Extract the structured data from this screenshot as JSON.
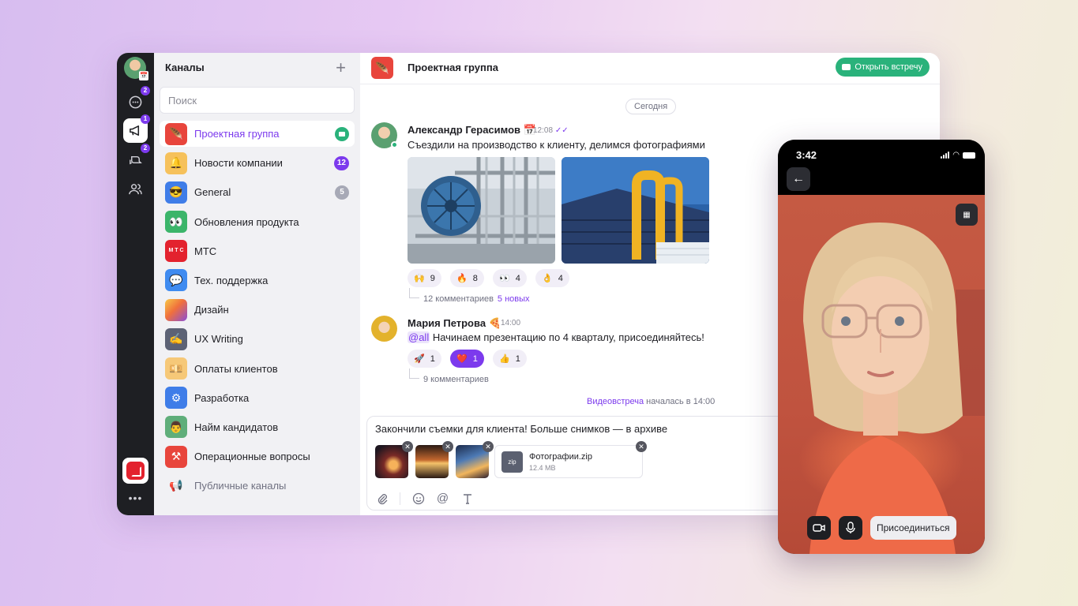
{
  "rail": {
    "chat_badge": "2",
    "channels_badge": "1",
    "threads_badge": "2",
    "more_label": "•••"
  },
  "sidebar": {
    "title": "Каналы",
    "add_icon": "+",
    "search_placeholder": "Поиск",
    "channels": [
      {
        "name": "Проектная группа",
        "icon": "🪶",
        "color": "#e8453c",
        "active": true,
        "call": true
      },
      {
        "name": "Новости компании",
        "icon": "🔔",
        "color": "#f6c15b",
        "count": "12"
      },
      {
        "name": "General",
        "icon": "😎",
        "color": "#3f7de8",
        "count": "5",
        "muted": true
      },
      {
        "name": "Обновления продукта",
        "icon": "👀",
        "color": "#3bb56a"
      },
      {
        "name": "МТС",
        "icon": "М Т С",
        "color": "#e3222e"
      },
      {
        "name": "Тех. поддержка",
        "icon": "💬",
        "color": "#3f8bf0"
      },
      {
        "name": "Дизайн",
        "icon": "",
        "color": "#f08a3c"
      },
      {
        "name": "UX Writing",
        "icon": "✍",
        "color": "#5c6275"
      },
      {
        "name": "Оплаты клиентов",
        "icon": "💴",
        "color": "#f6c878"
      },
      {
        "name": "Разработка",
        "icon": "⚙",
        "color": "#3f7de8"
      },
      {
        "name": "Найм кандидатов",
        "icon": "👨",
        "color": "#5fae7a"
      },
      {
        "name": "Операционные вопросы",
        "icon": "⚒",
        "color": "#e8453c"
      },
      {
        "name": "Публичные каналы",
        "icon": "📢",
        "public": true
      }
    ]
  },
  "chat": {
    "title": "Проектная группа",
    "open_meeting_label": "Открыть встречу",
    "date_divider": "Сегодня",
    "messages": [
      {
        "author": "Александр Герасимов",
        "emoji": "📅",
        "time": "12:08",
        "read_mark": "✓✓",
        "text": "Съездили на производство к клиенту, делимся фотографиями",
        "reactions": [
          {
            "emoji": "🙌",
            "count": "9"
          },
          {
            "emoji": "🔥",
            "count": "8"
          },
          {
            "emoji": "👀",
            "count": "4"
          },
          {
            "emoji": "👌",
            "count": "4"
          }
        ],
        "thread": "12 комментариев",
        "thread_new": "5 новых"
      },
      {
        "author": "Мария Петрова",
        "emoji": "🍕",
        "time": "14:00",
        "mention": "@all",
        "text": " Начинаем презентацию по 4 кварталу, присоединяйтесь!",
        "reactions": [
          {
            "emoji": "🚀",
            "count": "1"
          },
          {
            "emoji": "❤️",
            "count": "1",
            "active": true
          },
          {
            "emoji": "👍",
            "count": "1"
          }
        ],
        "thread": "9 комментариев"
      }
    ],
    "system": {
      "link": "Видеовстреча",
      "text": " началась в 14:00"
    },
    "composer": {
      "text": "Закончили съемки для клиента! Больше снимков — в архиве",
      "file_name": "Фотографии.zip",
      "file_size": "12.4 MB",
      "file_type": "zip"
    }
  },
  "phone": {
    "time": "3:42",
    "join_label": "Присоединиться"
  },
  "colors": {
    "accent": "#7c3aed",
    "green": "#2ab27b",
    "rail": "#1e1f23"
  }
}
